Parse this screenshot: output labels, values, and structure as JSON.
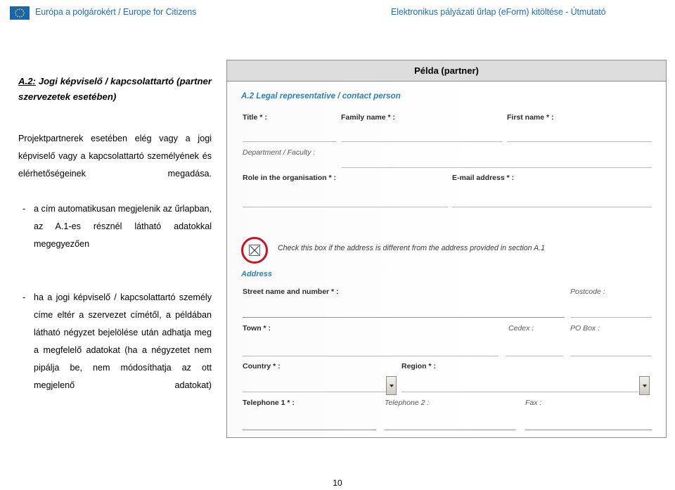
{
  "header": {
    "logo_icon": "eu-flag-icon",
    "left_text": "Európa a polgárokért / Europe for Citizens",
    "right_text": "Elektronikus pályázati űrlap (eForm) kitöltése - Útmutató",
    "accent_color": "#1f6fba"
  },
  "left_column": {
    "heading_label": "A.2:",
    "heading_rest": " Jogi képviselő / kapcsolattartó (partner szervezetek esetében)",
    "intro_paragraph": "Projektpartnerek esetében elég vagy a jogi képviselő vagy a kapcsolattartó személyének és elérhetőségeinek megadása.",
    "bullets": [
      "a cím automatikusan megjelenik az űrlapban, az A.1-es résznél látható adatokkal megegyezően",
      "ha a jogi képviselő / kapcsolattartó személy címe eltér a szervezet címétől, a példában látható négyzet bejelölése után adhatja meg a megfelelő adatokat (ha a négyzetet nem pipálja be, nem módosíthatja az ott megjelenő adatokat)"
    ]
  },
  "example_panel": {
    "title": "Példa (partner)",
    "form_section_heading": "A.2 Legal representative / contact person",
    "address_section_heading": "Address",
    "fields": {
      "title": "Title * :",
      "family_name": "Family name * :",
      "first_name": "First name * :",
      "department_faculty": "Department / Faculty :",
      "role_in_organisation": "Role in the organisation * :",
      "email_address": "E-mail address * :",
      "street_name_and_number": "Street name and number * :",
      "postcode": "Postcode :",
      "town": "Town * :",
      "cedex": "Cedex :",
      "po_box": "PO Box :",
      "country": "Country * :",
      "region": "Region * :",
      "telephone_1": "Telephone 1 * :",
      "telephone_2": "Telephone 2 :",
      "fax": "Fax :"
    },
    "checkbox": {
      "state": "checked",
      "caption": "Check this box if the address is different from the address provided  in section A.1",
      "annotation_color": "#cc1122"
    },
    "heading_color": "#2c7fb8"
  },
  "footer": {
    "page_number": "10"
  }
}
